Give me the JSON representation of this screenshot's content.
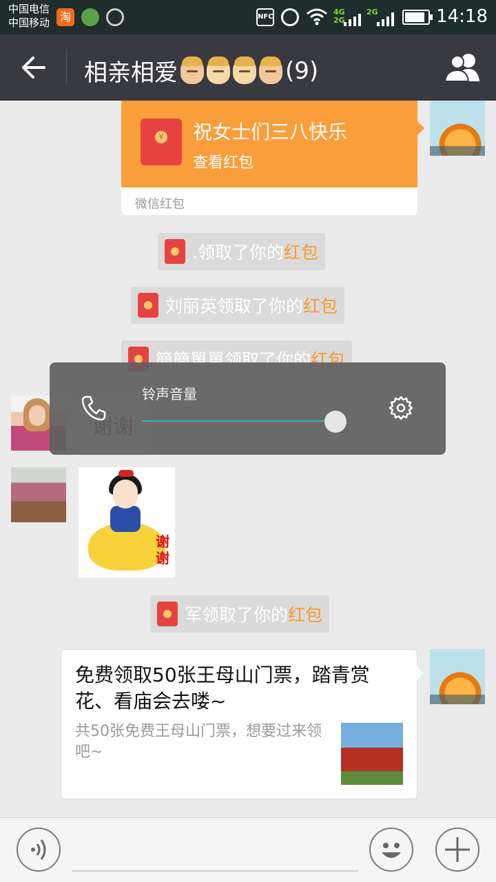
{
  "status_bar": {
    "carrier1": "中国电信",
    "carrier2": "中国移动",
    "taobao": "淘",
    "nfc": "NFC",
    "net_4g": "4G",
    "net_2g_a": "2G",
    "net_2g_b": "2G",
    "time": "14:18"
  },
  "header": {
    "title": "相亲相爱",
    "member_count": "(9)",
    "back_icon": "back-arrow-icon",
    "group_icon": "group-members-icon"
  },
  "messages": {
    "red_packet": {
      "title": "祝女士们三八快乐",
      "action": "查看红包",
      "footer": "微信红包"
    },
    "system": [
      {
        "who": ".领取了你的",
        "hl": "红包"
      },
      {
        "who": "刘丽英领取了你的",
        "hl": "红包"
      },
      {
        "who": "簡簡單單领取了你的",
        "hl": "红包"
      },
      {
        "who": "军领取了你的",
        "hl": "红包"
      }
    ],
    "text_left": "谢谢",
    "sticker_text": "谢谢",
    "card": {
      "title": "免费领取50张王母山门票，踏青赏花、看庙会去喽~",
      "desc": "共50张免费王母山门票，想要过来领吧~"
    }
  },
  "volume_popup": {
    "label": "铃声音量",
    "level": 0.95
  },
  "colors": {
    "titlebar": "#393a3f",
    "red_packet": "#fa9d3b",
    "highlight": "#f79b29",
    "slider": "#3bb3b6"
  }
}
